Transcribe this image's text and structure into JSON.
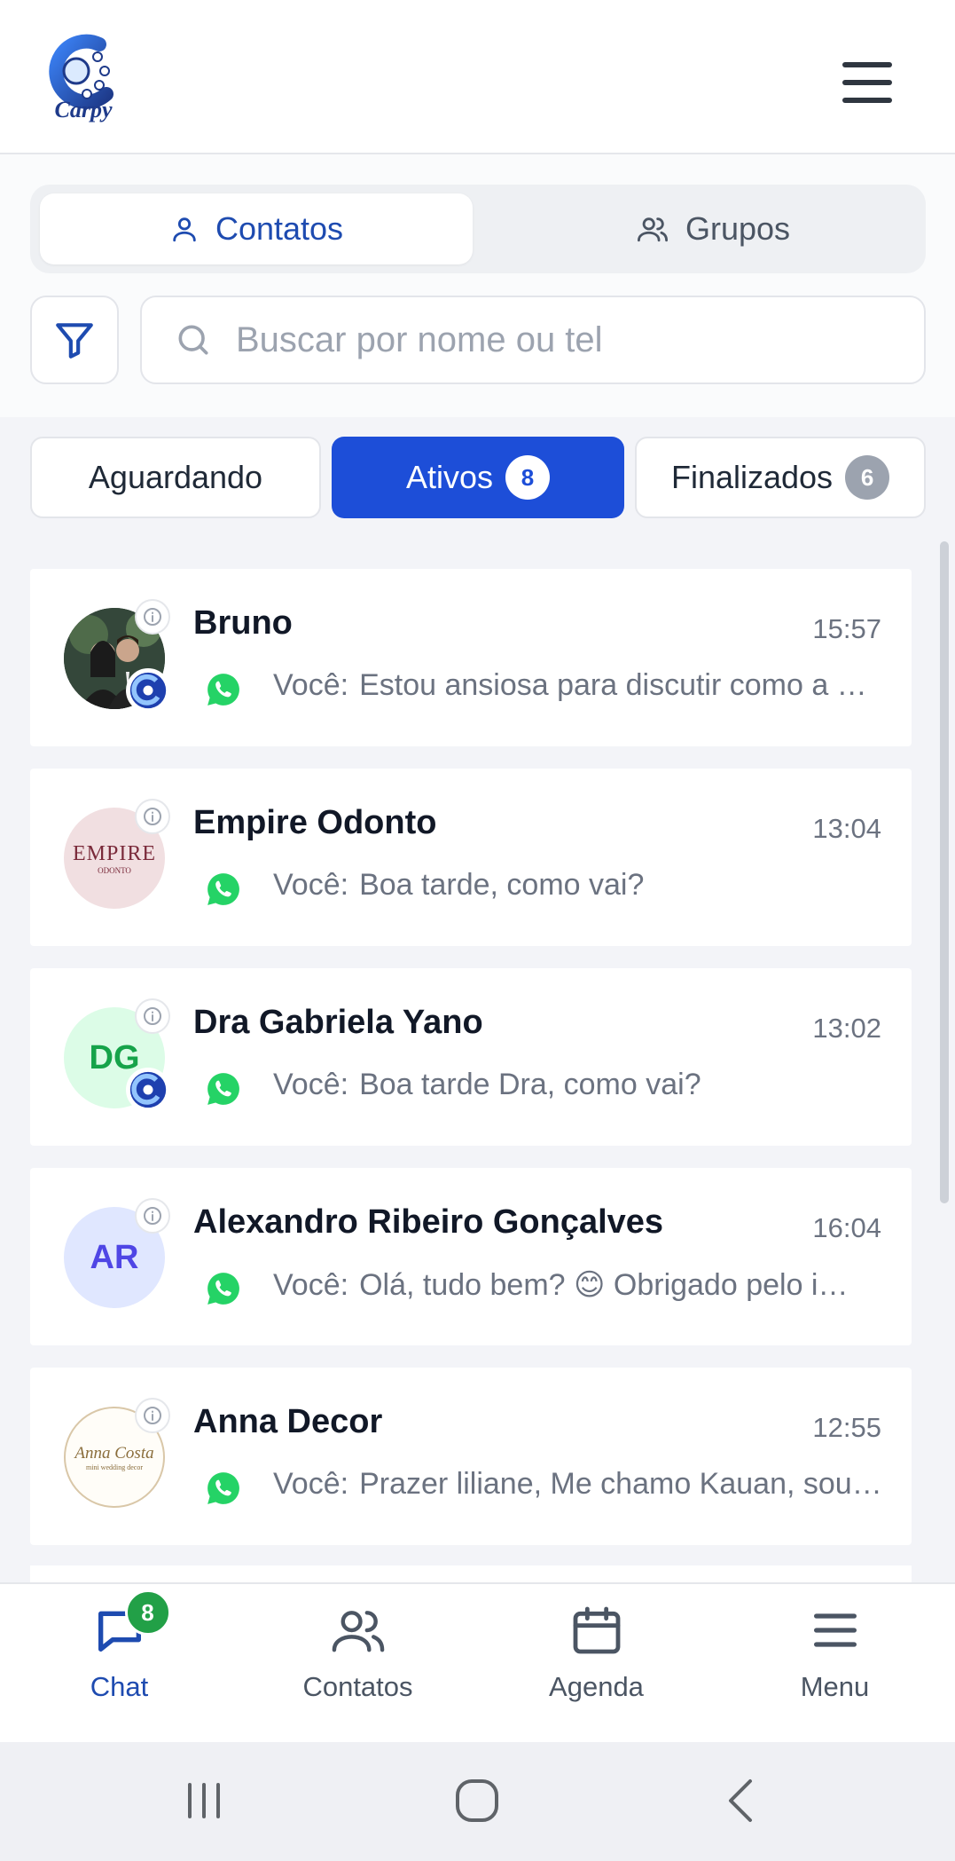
{
  "header": {
    "logo_text": "Carpy",
    "menu_icon": "hamburger-icon"
  },
  "contact_toggle": {
    "contatos_label": "Contatos",
    "grupos_label": "Grupos"
  },
  "search": {
    "placeholder": "Buscar por nome ou tel",
    "value": ""
  },
  "status_tabs": {
    "aguardando": {
      "label": "Aguardando"
    },
    "ativos": {
      "label": "Ativos",
      "count": "8"
    },
    "finalizados": {
      "label": "Finalizados",
      "count": "6"
    }
  },
  "conversations": [
    {
      "name": "Bruno",
      "time": "15:57",
      "you": "Você:",
      "message": "Estou ansiosa para discutir como a …",
      "avatar": "photo"
    },
    {
      "name": "Empire Odonto",
      "time": "13:04",
      "you": "Você:",
      "message": "Boa tarde, como vai?",
      "avatar": "logo",
      "avatar_text": "EMPIRE",
      "avatar_sub": "ODONTO"
    },
    {
      "name": "Dra Gabriela Yano",
      "time": "13:02",
      "you": "Você:",
      "message": "Boa tarde Dra, como vai?",
      "avatar": "initials",
      "initials": "DG"
    },
    {
      "name": "Alexandro Ribeiro Gonçalves",
      "time": "16:04",
      "you": "Você:",
      "message": "Olá, tudo bem? 😊 Obrigado pelo i…",
      "avatar": "initials",
      "initials": "AR"
    },
    {
      "name": "Anna Decor",
      "time": "12:55",
      "you": "Você:",
      "message": "Prazer liliane, Me chamo Kauan, sou…",
      "avatar": "logo",
      "avatar_text": "Anna Costa",
      "avatar_sub": "mini wedding decor"
    }
  ],
  "bottom_nav": {
    "chat": {
      "label": "Chat",
      "badge": "8"
    },
    "contatos": {
      "label": "Contatos"
    },
    "agenda": {
      "label": "Agenda"
    },
    "menu": {
      "label": "Menu"
    }
  },
  "colors": {
    "accent": "#1d4ed8",
    "whatsapp": "#25d366",
    "badge_green": "#22a047"
  }
}
